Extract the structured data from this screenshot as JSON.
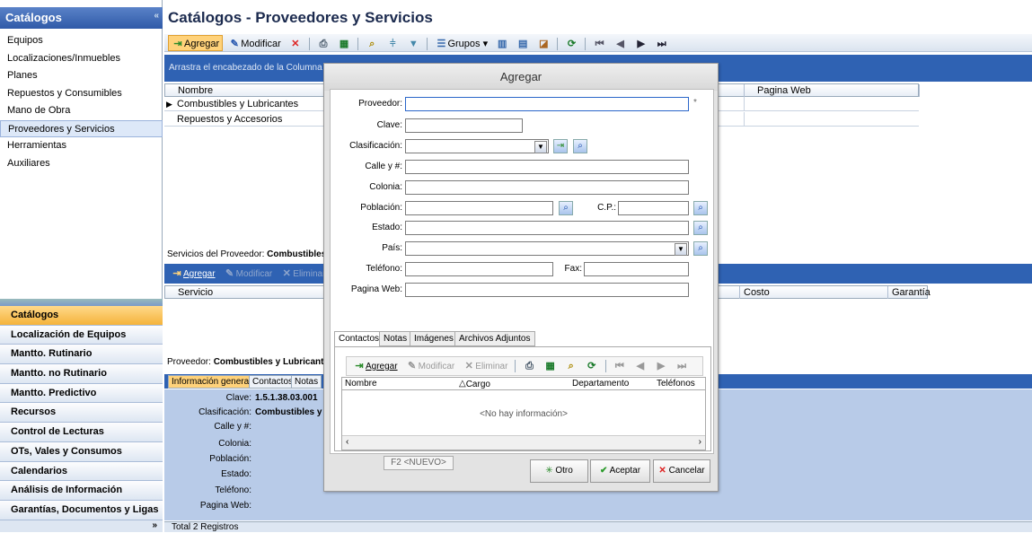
{
  "nav": {
    "title": "Catálogos",
    "collapse": "«",
    "items": [
      "Equipos",
      "Localizaciones/Inmuebles",
      "Planes",
      "Repuestos y Consumibles",
      "Mano de Obra",
      "Proveedores y Servicios",
      "Herramientas",
      "Auxiliares"
    ],
    "bands": [
      "Catálogos",
      "Localización de Equipos",
      "Mantto. Rutinario",
      "Mantto. no Rutinario",
      "Mantto. Predictivo",
      "Recursos",
      "Control de Lecturas",
      "OTs, Vales y Consumos",
      "Calendarios",
      "Análisis de Información",
      "Garantías, Documentos y Ligas"
    ],
    "more": "»"
  },
  "page": {
    "title": "Catálogos - Proveedores y Servicios"
  },
  "toolbar": {
    "add": "Agregar",
    "edit": "Modificar",
    "groups": "Grupos"
  },
  "grid": {
    "group_hint": "Arrastra el encabezado de la Columna a es",
    "cols": [
      "Nombre",
      "Pagina Web"
    ],
    "rows": [
      "Combustibles y Lubricantes",
      "Repuestos y Accesorios"
    ]
  },
  "services": {
    "title_prefix": "Servicios del Proveedor:",
    "title_value": "Combustibles y",
    "add": "Agregar",
    "edit": "Modificar",
    "del": "Eliminar",
    "cols": [
      "Servicio",
      "Costo",
      "Garantía"
    ]
  },
  "provider": {
    "title_prefix": "Proveedor:",
    "title_value": "Combustibles y Lubricante",
    "tabs": [
      "Información general",
      "Contactos",
      "Notas"
    ],
    "fields": [
      {
        "label": "Clave:",
        "value": "1.5.1.38.03.001"
      },
      {
        "label": "Clasificación:",
        "value": "Combustibles y Lub"
      },
      {
        "label": "Calle y #:",
        "value": ""
      },
      {
        "label": "Colonia:",
        "value": ""
      },
      {
        "label": "Población:",
        "value": ""
      },
      {
        "label": "Estado:",
        "value": ""
      },
      {
        "label": "Teléfono:",
        "value": ""
      },
      {
        "label": "Pagina Web:",
        "value": ""
      }
    ]
  },
  "status": {
    "total": "Total 2 Registros"
  },
  "dialog": {
    "title": "Agregar",
    "labels": {
      "proveedor": "Proveedor:",
      "clave": "Clave:",
      "clasificacion": "Clasificación:",
      "calle": "Calle y #:",
      "colonia": "Colonia:",
      "poblacion": "Población:",
      "cp": "C.P.:",
      "estado": "Estado:",
      "pais": "País:",
      "telefono": "Teléfono:",
      "fax": "Fax:",
      "web": "Pagina Web:"
    },
    "required": "*",
    "tabs": [
      "Contactos",
      "Notas",
      "Imágenes",
      "Archivos Adjuntos"
    ],
    "ctoolbar": {
      "add": "Agregar",
      "edit": "Modificar",
      "del": "Eliminar"
    },
    "ccols": [
      "Nombre",
      "Cargo",
      "Departamento",
      "Teléfonos"
    ],
    "nodata": "<No hay información>",
    "f2": "F2 <NUEVO>",
    "buttons": {
      "otro": "Otro",
      "aceptar": "Aceptar",
      "cancelar": "Cancelar"
    }
  }
}
